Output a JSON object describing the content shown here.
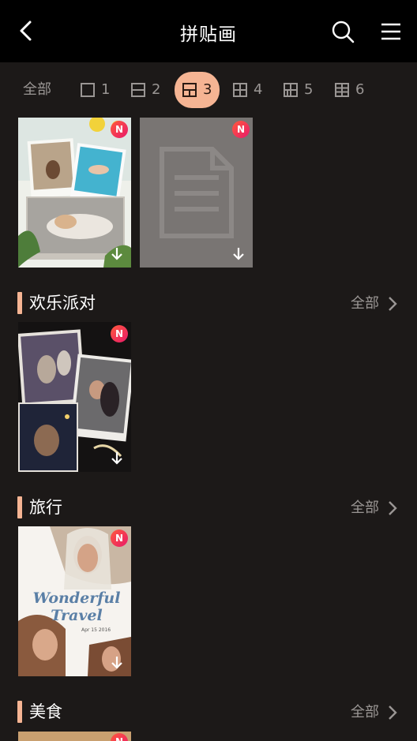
{
  "header": {
    "title": "拼贴画"
  },
  "filters": [
    {
      "label": "全部",
      "icon": "none"
    },
    {
      "label": "1",
      "icon": "layout-1-icon"
    },
    {
      "label": "2",
      "icon": "layout-2-icon"
    },
    {
      "label": "3",
      "icon": "layout-3-icon",
      "active": true
    },
    {
      "label": "4",
      "icon": "layout-4-icon"
    },
    {
      "label": "5",
      "icon": "layout-5-icon"
    },
    {
      "label": "6",
      "icon": "layout-6-icon"
    }
  ],
  "badge_label": "N",
  "sections": [
    {
      "name": "欢乐派对",
      "more": "全部"
    },
    {
      "name": "旅行",
      "more": "全部"
    },
    {
      "name": "美食",
      "more": "全部"
    }
  ],
  "travel_card": {
    "title_line1": "Wonderful",
    "title_line2": "Travel",
    "date": "Apr 15 2016"
  },
  "colors": {
    "accent": "#f5b493",
    "background": "#1c1918",
    "header": "#000000",
    "muted_text": "#9a9694",
    "badge": "#e8196a"
  }
}
